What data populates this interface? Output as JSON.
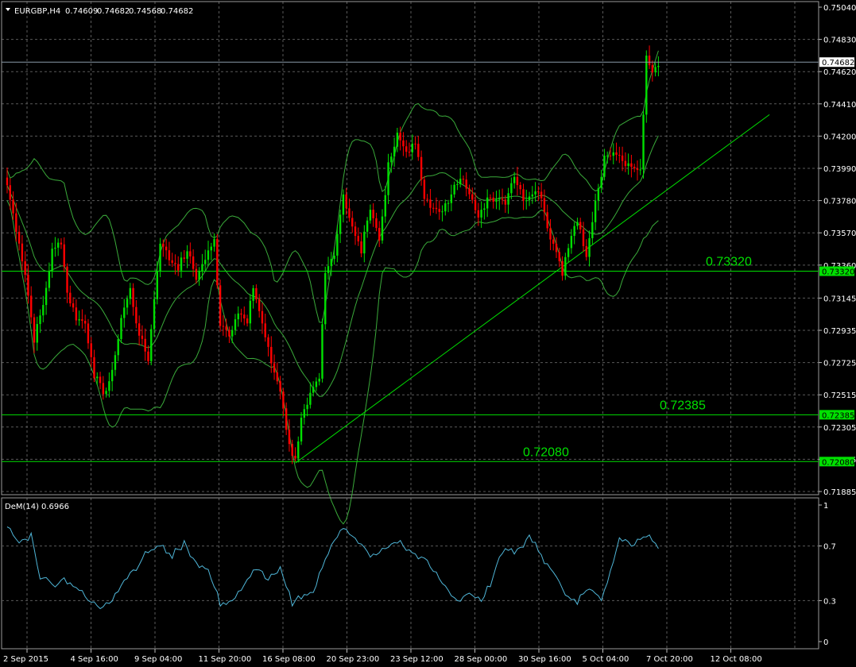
{
  "header": {
    "symbol": "EURGBP,H4",
    "open": "0.74609",
    "high": "0.74682",
    "low": "0.74568",
    "close": "0.74682"
  },
  "indicator": {
    "name": "DeM(14)",
    "value": "0.6966"
  },
  "colors": {
    "background": "#000000",
    "bull": "#00e000",
    "bear": "#ff0000",
    "bands": "#3aaa3a",
    "trendline": "#00e000",
    "level": "#00e000",
    "bid_line": "#8a9aa8",
    "demarker": "#4fb6d8",
    "grid": "#5a5a5a",
    "text": "#ffffff"
  },
  "chart_data": [
    {
      "type": "candlestick",
      "title": "EURGBP,H4",
      "price_axis_ticks": [
        "0.75040",
        "0.74830",
        "0.74620",
        "0.74410",
        "0.74200",
        "0.73990",
        "0.73780",
        "0.73570",
        "0.73360",
        "0.73145",
        "0.72935",
        "0.72725",
        "0.72515",
        "0.72305",
        "0.72095",
        "0.71885"
      ],
      "ylim": [
        0.71885,
        0.7504
      ],
      "time_axis_labels": [
        "2 Sep 2015",
        "4 Sep 16:00",
        "9 Sep 04:00",
        "11 Sep 20:00",
        "16 Sep 08:00",
        "20 Sep 23:00",
        "23 Sep 12:00",
        "28 Sep 00:00",
        "30 Sep 16:00",
        "5 Oct 04:00",
        "7 Oct 20:00",
        "12 Oct 08:00"
      ],
      "current_price": "0.74682",
      "levels": [
        {
          "price": 0.7332,
          "label": "0.73320",
          "tag": "0.73320"
        },
        {
          "price": 0.72385,
          "label": "0.72385",
          "tag": "0.72385"
        },
        {
          "price": 0.7208,
          "label": "0.72080",
          "tag": "0.72080"
        }
      ],
      "trendline": {
        "start_price": 0.7207,
        "start_index": 96,
        "end_price": 0.7434,
        "end_index": 254
      },
      "close_anchors": [
        [
          0,
          0.7388
        ],
        [
          3,
          0.736
        ],
        [
          6,
          0.733
        ],
        [
          9,
          0.7288
        ],
        [
          12,
          0.731
        ],
        [
          15,
          0.7345
        ],
        [
          18,
          0.7352
        ],
        [
          20,
          0.7318
        ],
        [
          23,
          0.7302
        ],
        [
          26,
          0.7298
        ],
        [
          29,
          0.7265
        ],
        [
          32,
          0.7252
        ],
        [
          35,
          0.7265
        ],
        [
          38,
          0.7302
        ],
        [
          41,
          0.732
        ],
        [
          44,
          0.729
        ],
        [
          47,
          0.7275
        ],
        [
          51,
          0.7352
        ],
        [
          54,
          0.734
        ],
        [
          57,
          0.7335
        ],
        [
          60,
          0.7345
        ],
        [
          63,
          0.7328
        ],
        [
          66,
          0.734
        ],
        [
          69,
          0.7352
        ],
        [
          71,
          0.7298
        ],
        [
          74,
          0.7292
        ],
        [
          77,
          0.7305
        ],
        [
          80,
          0.7298
        ],
        [
          82,
          0.7322
        ],
        [
          85,
          0.7298
        ],
        [
          88,
          0.7272
        ],
        [
          91,
          0.7255
        ],
        [
          94,
          0.7218
        ],
        [
          96,
          0.721
        ],
        [
          98,
          0.7235
        ],
        [
          101,
          0.725
        ],
        [
          104,
          0.7262
        ],
        [
          106,
          0.733
        ],
        [
          109,
          0.7345
        ],
        [
          112,
          0.7382
        ],
        [
          115,
          0.736
        ],
        [
          118,
          0.7345
        ],
        [
          121,
          0.7375
        ],
        [
          124,
          0.7352
        ],
        [
          127,
          0.74
        ],
        [
          130,
          0.742
        ],
        [
          133,
          0.741
        ],
        [
          136,
          0.7415
        ],
        [
          139,
          0.7382
        ],
        [
          142,
          0.7372
        ],
        [
          145,
          0.737
        ],
        [
          148,
          0.7382
        ],
        [
          151,
          0.7395
        ],
        [
          154,
          0.7385
        ],
        [
          157,
          0.7365
        ],
        [
          160,
          0.738
        ],
        [
          163,
          0.738
        ],
        [
          166,
          0.7378
        ],
        [
          169,
          0.7395
        ],
        [
          172,
          0.7378
        ],
        [
          175,
          0.7385
        ],
        [
          178,
          0.7382
        ],
        [
          180,
          0.736
        ],
        [
          183,
          0.7345
        ],
        [
          185,
          0.7332
        ],
        [
          188,
          0.7355
        ],
        [
          190,
          0.7365
        ],
        [
          193,
          0.734
        ],
        [
          196,
          0.7378
        ],
        [
          199,
          0.7405
        ],
        [
          202,
          0.7412
        ],
        [
          205,
          0.7405
        ],
        [
          208,
          0.74
        ],
        [
          211,
          0.7398
        ],
        [
          213,
          0.747
        ],
        [
          215,
          0.7462
        ],
        [
          217,
          0.7468
        ]
      ],
      "demarker": {
        "axis_ticks": [
          "1",
          "0.7",
          "0.3",
          "0"
        ],
        "ylim": [
          0,
          1
        ],
        "anchors": [
          [
            0,
            0.84
          ],
          [
            4,
            0.72
          ],
          [
            8,
            0.78
          ],
          [
            11,
            0.48
          ],
          [
            15,
            0.42
          ],
          [
            19,
            0.46
          ],
          [
            23,
            0.4
          ],
          [
            27,
            0.3
          ],
          [
            31,
            0.25
          ],
          [
            35,
            0.32
          ],
          [
            39,
            0.45
          ],
          [
            43,
            0.55
          ],
          [
            47,
            0.66
          ],
          [
            51,
            0.7
          ],
          [
            55,
            0.63
          ],
          [
            59,
            0.72
          ],
          [
            63,
            0.58
          ],
          [
            67,
            0.52
          ],
          [
            71,
            0.28
          ],
          [
            75,
            0.3
          ],
          [
            79,
            0.4
          ],
          [
            83,
            0.55
          ],
          [
            87,
            0.45
          ],
          [
            91,
            0.52
          ],
          [
            95,
            0.28
          ],
          [
            98,
            0.34
          ],
          [
            102,
            0.36
          ],
          [
            106,
            0.6
          ],
          [
            109,
            0.76
          ],
          [
            112,
            0.84
          ],
          [
            115,
            0.76
          ],
          [
            118,
            0.7
          ],
          [
            122,
            0.62
          ],
          [
            126,
            0.68
          ],
          [
            130,
            0.74
          ],
          [
            134,
            0.66
          ],
          [
            138,
            0.62
          ],
          [
            142,
            0.52
          ],
          [
            146,
            0.4
          ],
          [
            150,
            0.3
          ],
          [
            154,
            0.36
          ],
          [
            158,
            0.28
          ],
          [
            162,
            0.48
          ],
          [
            166,
            0.7
          ],
          [
            170,
            0.66
          ],
          [
            174,
            0.78
          ],
          [
            178,
            0.62
          ],
          [
            182,
            0.52
          ],
          [
            186,
            0.34
          ],
          [
            190,
            0.3
          ],
          [
            194,
            0.4
          ],
          [
            198,
            0.3
          ],
          [
            201,
            0.52
          ],
          [
            204,
            0.76
          ],
          [
            208,
            0.72
          ],
          [
            212,
            0.78
          ],
          [
            215,
            0.74
          ],
          [
            217,
            0.7
          ]
        ]
      }
    }
  ]
}
